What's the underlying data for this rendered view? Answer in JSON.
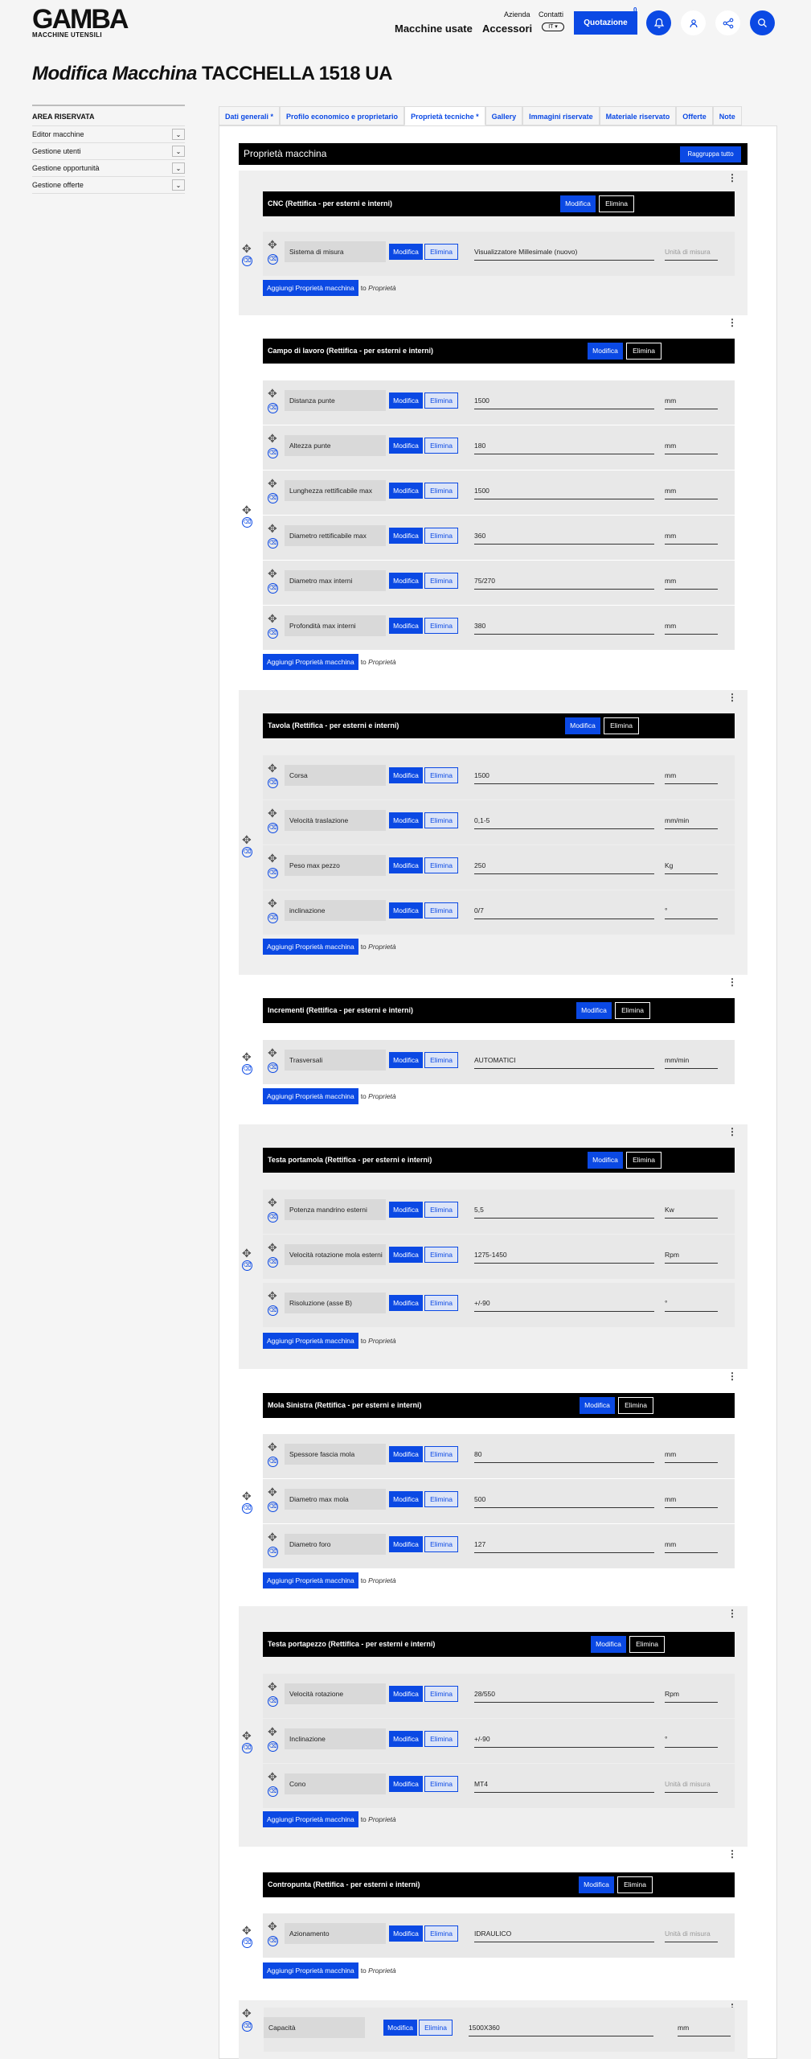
{
  "header": {
    "logo_main": "GAMBA",
    "logo_sub": "MACCHINE UTENSILI",
    "nav_used": "Macchine usate",
    "nav_accessories": "Accessori",
    "nav_company": "Azienda",
    "nav_contacts": "Contatti",
    "lang": "IT",
    "quote_label": "Quotazione",
    "quote_count": "0"
  },
  "page": {
    "title_em": "Modifica Macchina",
    "title_rest": "TACCHELLA 1518 UA"
  },
  "sidebar": {
    "heading": "AREA RISERVATA",
    "items": [
      {
        "label": "Editor macchine"
      },
      {
        "label": "Gestione utenti"
      },
      {
        "label": "Gestione opportunità"
      },
      {
        "label": "Gestione offerte"
      }
    ]
  },
  "tabs": [
    {
      "label": "Dati generali *"
    },
    {
      "label": "Profilo economico e proprietario"
    },
    {
      "label": "Proprietà tecniche *"
    },
    {
      "label": "Gallery"
    },
    {
      "label": "Immagini riservate"
    },
    {
      "label": "Materiale riservato"
    },
    {
      "label": "Offerte"
    },
    {
      "label": "Note"
    }
  ],
  "panel": {
    "title": "Proprietà macchina",
    "collapse_all": "Raggruppa tutto"
  },
  "labels": {
    "edit": "Modifica",
    "delete": "Elimina",
    "add": "Aggiungi Proprietà macchina",
    "to": "to",
    "to_target": "Proprietà",
    "unit_placeholder": "Unità di misura"
  },
  "groups": [
    {
      "title": "CNC (Rettifica - per esterni e interni)",
      "props": [
        {
          "label": "Sistema di misura",
          "value": "Visualizzatore Millesimale (nuovo)",
          "unit": ""
        }
      ]
    },
    {
      "title": "Campo di lavoro (Rettifica - per esterni e interni)",
      "props": [
        {
          "label": "Distanza punte",
          "value": "1500",
          "unit": "mm"
        },
        {
          "label": "Altezza punte",
          "value": "180",
          "unit": "mm"
        },
        {
          "label": "Lunghezza rettificabile max",
          "value": "1500",
          "unit": "mm"
        },
        {
          "label": "Diametro rettificabile max",
          "value": "360",
          "unit": "mm"
        },
        {
          "label": "Diametro max interni",
          "value": "75/270",
          "unit": "mm"
        },
        {
          "label": "Profondità max interni",
          "value": "380",
          "unit": "mm"
        }
      ]
    },
    {
      "title": "Tavola (Rettifica - per esterni e interni)",
      "props": [
        {
          "label": "Corsa",
          "value": "1500",
          "unit": "mm"
        },
        {
          "label": "Velocità traslazione",
          "value": "0,1-5",
          "unit": "mm/min"
        },
        {
          "label": "Peso max pezzo",
          "value": "250",
          "unit": "Kg"
        },
        {
          "label": "inclinazione",
          "value": "0/7",
          "unit": "°"
        }
      ]
    },
    {
      "title": "Incrementi (Rettifica - per esterni e interni)",
      "props": [
        {
          "label": "Trasversali",
          "value": "AUTOMATICI",
          "unit": "mm/min"
        }
      ]
    },
    {
      "title": "Testa portamola (Rettifica - per esterni e interni)",
      "props": [
        {
          "label": "Potenza mandrino esterni",
          "value": "5,5",
          "unit": "Kw"
        },
        {
          "label": "Velocità rotazione mola esterni",
          "value": "1275-1450",
          "unit": "Rpm"
        },
        {
          "label": "Risoluzione (asse B)",
          "value": "+/-90",
          "unit": "°"
        }
      ]
    },
    {
      "title": "Mola Sinistra (Rettifica - per esterni e interni)",
      "props": [
        {
          "label": "Spessore fascia mola",
          "value": "80",
          "unit": "mm"
        },
        {
          "label": "Diametro max mola",
          "value": "500",
          "unit": "mm"
        },
        {
          "label": "Diametro foro",
          "value": "127",
          "unit": "mm"
        }
      ]
    },
    {
      "title": "Testa portapezzo (Rettifica - per esterni e interni)",
      "props": [
        {
          "label": "Velocità rotazione",
          "value": "28/550",
          "unit": "Rpm"
        },
        {
          "label": "Inclinazione",
          "value": "+/-90",
          "unit": "°"
        },
        {
          "label": "Cono",
          "value": "MT4",
          "unit": ""
        }
      ]
    },
    {
      "title": "Contropunta (Rettifica - per esterni e interni)",
      "props": [
        {
          "label": "Azionamento",
          "value": "IDRAULICO",
          "unit": ""
        }
      ]
    }
  ],
  "loose": {
    "label": "Capacità",
    "value": "1500X360",
    "unit": "mm"
  },
  "colors": {
    "accent": "#0b49e4",
    "header_bar": "#000000",
    "panel_bg": "#ffffff",
    "page_bg": "#f5f5f5"
  }
}
